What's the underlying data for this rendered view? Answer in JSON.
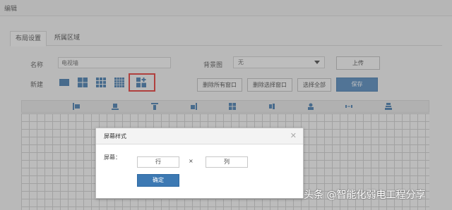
{
  "window": {
    "title": "编辑"
  },
  "tabs": [
    {
      "label": "布局设置",
      "active": true
    },
    {
      "label": "所属区域",
      "active": false
    }
  ],
  "form": {
    "name_label": "名称",
    "name_value": "电视墙",
    "bg_label": "背景图",
    "bg_value": "无",
    "upload_label": "上传",
    "new_label": "新建",
    "layout_icons": [
      "layout-1x1-icon",
      "layout-2x2-icon",
      "layout-3x3-icon",
      "layout-4x4-icon",
      "layout-custom-icon"
    ]
  },
  "actions": {
    "delete_all": "删除所有窗口",
    "delete_selected": "删除选择窗口",
    "select_all": "选择全部",
    "save": "保存"
  },
  "grid_header_icons": [
    "align-left-icon",
    "align-bottom-icon",
    "align-top-icon",
    "align-right-icon",
    "tile-icon",
    "align-center-icon",
    "user-icon",
    "swap-icon",
    "stack-icon"
  ],
  "colors": {
    "primary": "#3d79b3",
    "highlight": "#e0201c"
  },
  "modal": {
    "title": "屏幕样式",
    "screen_label": "屏幕：",
    "rows_placeholder": "行",
    "times": "×",
    "cols_placeholder": "列",
    "confirm_label": "确定"
  },
  "watermark": "头条 @智能化弱电工程分享"
}
